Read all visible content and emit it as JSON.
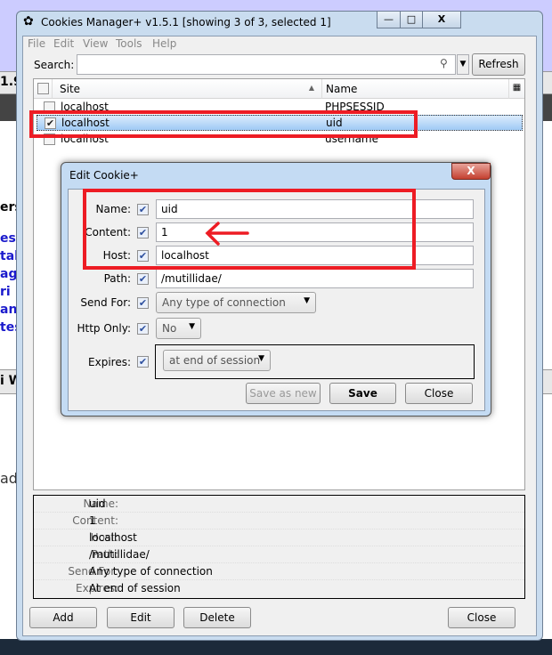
{
  "background": {
    "fragments": [
      "ers",
      "es",
      "tall",
      "ag",
      "ri",
      "an",
      "tes",
      "i W",
      "ad",
      "1.9"
    ]
  },
  "window": {
    "title": "Cookies Manager+ v1.5.1 [showing 3 of 3, selected 1]",
    "minimize": "—",
    "maximize": "□",
    "close": "X"
  },
  "menu": [
    "File",
    "Edit",
    "View",
    "Tools",
    "Help"
  ],
  "search": {
    "label": "Search:",
    "value": "",
    "refresh": "Refresh"
  },
  "list": {
    "columns": [
      "Site",
      "Name"
    ],
    "rows": [
      {
        "site": "localhost",
        "name": "PHPSESSID",
        "checked": false,
        "selected": false
      },
      {
        "site": "localhost",
        "name": "uid",
        "checked": true,
        "selected": true
      },
      {
        "site": "localhost",
        "name": "username",
        "checked": false,
        "selected": false
      }
    ]
  },
  "details": [
    {
      "label": "Name:",
      "value": "uid"
    },
    {
      "label": "Content:",
      "value": "1"
    },
    {
      "label": "Host:",
      "value": "localhost"
    },
    {
      "label": "Path:",
      "value": "/mutillidae/"
    },
    {
      "label": "Send For:",
      "value": "Any type of connection"
    },
    {
      "label": "Expires:",
      "value": "At end of session"
    }
  ],
  "buttons": {
    "add": "Add",
    "edit": "Edit",
    "delete": "Delete",
    "close": "Close"
  },
  "dialog": {
    "title": "Edit Cookie+",
    "close_icon": "X",
    "fields": {
      "name": {
        "label": "Name:",
        "value": "uid"
      },
      "content": {
        "label": "Content:",
        "value": "1"
      },
      "host": {
        "label": "Host:",
        "value": "localhost"
      },
      "path": {
        "label": "Path:",
        "value": "/mutillidae/"
      },
      "send_for": {
        "label": "Send For:",
        "value": "Any type of connection"
      },
      "http_only": {
        "label": "Http Only:",
        "value": "No"
      },
      "expires": {
        "label": "Expires:",
        "value": "at end of session"
      }
    },
    "save_as_new": "Save as new",
    "save": "Save",
    "close": "Close"
  },
  "annotation_color": "#ed1c24"
}
